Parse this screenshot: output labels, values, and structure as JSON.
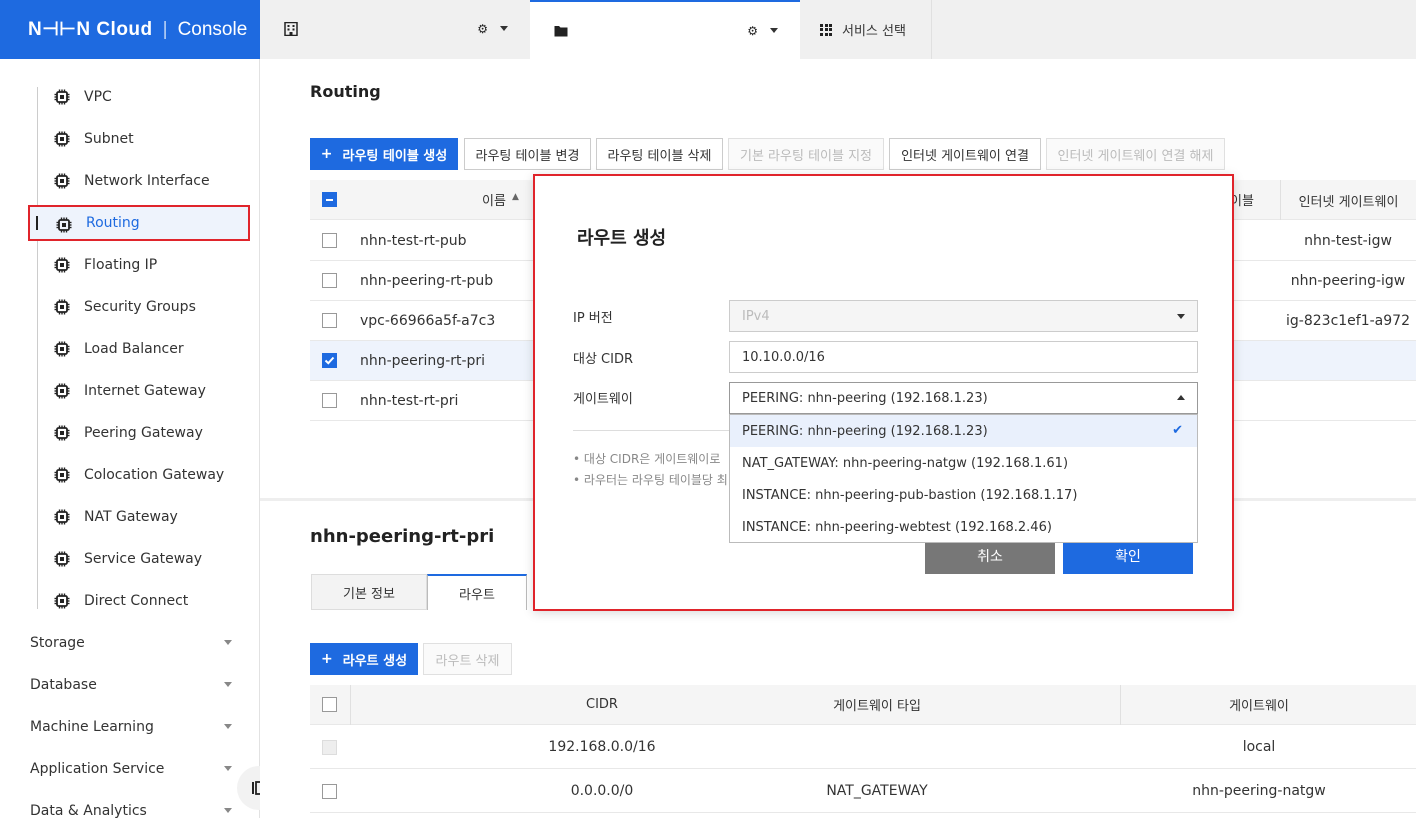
{
  "header": {
    "brand": "N⊣⊢N Cloud",
    "console": "Console",
    "service_select": "서비스 선택"
  },
  "sidebar": {
    "network_items": [
      "VPC",
      "Subnet",
      "Network Interface",
      "Routing",
      "Floating IP",
      "Security Groups",
      "Load Balancer",
      "Internet Gateway",
      "Peering Gateway",
      "Colocation Gateway",
      "NAT Gateway",
      "Service Gateway",
      "Direct Connect"
    ],
    "active_item": "Routing",
    "groups": [
      "Storage",
      "Database",
      "Machine Learning",
      "Application Service",
      "Data & Analytics"
    ]
  },
  "main": {
    "title": "Routing",
    "toolbar": {
      "create": "라우팅 테이블 생성",
      "change": "라우팅 테이블 변경",
      "delete": "라우팅 테이블 삭제",
      "set_default": "기본 라우팅 테이블 지정",
      "connect_igw": "인터넷 게이트웨이 연결",
      "disconnect_igw": "인터넷 게이트웨이 연결 해제"
    },
    "table": {
      "col_name": "이름",
      "col_default_partial": "이블",
      "col_igw": "인터넷 게이트웨이",
      "rows": [
        {
          "name": "nhn-test-rt-pub",
          "igw": "nhn-test-igw",
          "checked": false
        },
        {
          "name": "nhn-peering-rt-pub",
          "igw": "nhn-peering-igw",
          "checked": false
        },
        {
          "name": "vpc-66966a5f-a7c3",
          "igw": "ig-823c1ef1-a972",
          "checked": false
        },
        {
          "name": "nhn-peering-rt-pri",
          "igw": "",
          "checked": true
        },
        {
          "name": "nhn-test-rt-pri",
          "igw": "",
          "checked": false
        }
      ]
    },
    "detail": {
      "title": "nhn-peering-rt-pri",
      "tabs": [
        "기본 정보",
        "라우트"
      ],
      "create_route": "라우트 생성",
      "delete_route": "라우트 삭제",
      "columns": {
        "cidr": "CIDR",
        "gw_type": "게이트웨이 타입",
        "gateway": "게이트웨이"
      },
      "rows": [
        {
          "cidr": "192.168.0.0/16",
          "gw_type": "",
          "gateway": "local"
        },
        {
          "cidr": "0.0.0.0/0",
          "gw_type": "NAT_GATEWAY",
          "gateway": "nhn-peering-natgw"
        }
      ]
    }
  },
  "modal": {
    "title": "라우트 생성",
    "ip_version_label": "IP 버전",
    "ip_version_value": "IPv4",
    "cidr_label": "대상 CIDR",
    "cidr_value": "10.10.0.0/16",
    "gateway_label": "게이트웨이",
    "gateway_value": "PEERING: nhn-peering (192.168.1.23)",
    "options": [
      "PEERING: nhn-peering (192.168.1.23)",
      "NAT_GATEWAY: nhn-peering-natgw (192.168.1.61)",
      "INSTANCE: nhn-peering-pub-bastion (192.168.1.17)",
      "INSTANCE: nhn-peering-webtest (192.168.2.46)"
    ],
    "notes": [
      "대상 CIDR은 게이트웨이로",
      "라우터는 라우팅 테이블당 최"
    ],
    "cancel": "취소",
    "confirm": "확인"
  },
  "colors": {
    "accent": "#1e6ae0",
    "highlight": "#e0242b"
  }
}
